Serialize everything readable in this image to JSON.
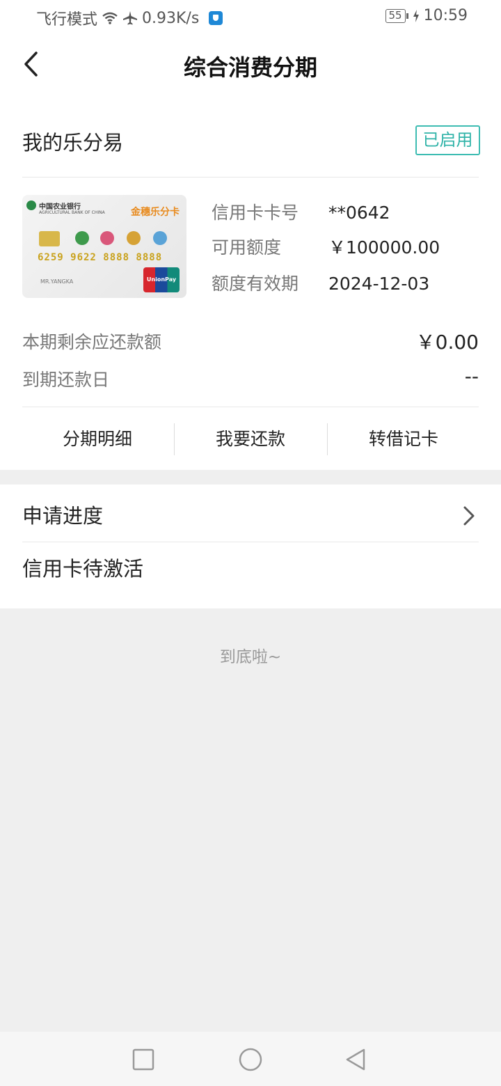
{
  "status_bar": {
    "airplane_text": "飞行模式",
    "speed": "0.93K/s",
    "battery": "55",
    "time": "10:59"
  },
  "header": {
    "title": "综合消费分期"
  },
  "installment": {
    "section_title": "我的乐分易",
    "status_badge": "已启用",
    "card": {
      "bank_name": "中国农业银行",
      "bank_sub": "AGRICULTURAL BANK OF CHINA",
      "brand": "金穗乐分卡",
      "number": "6259 9622 8888 8888",
      "holder": "MR.YANGKA",
      "network": "UnionPay 银联"
    },
    "card_no_label": "信用卡卡号",
    "card_no_value": "**0642",
    "limit_label": "可用额度",
    "limit_value": "￥100000.00",
    "validity_label": "额度有效期",
    "validity_value": "2024-12-03",
    "remaining_label": "本期剩余应还款额",
    "remaining_value": "￥0.00",
    "due_label": "到期还款日",
    "due_value": "--",
    "actions": [
      "分期明细",
      "我要还款",
      "转借记卡"
    ]
  },
  "progress": {
    "title": "申请进度",
    "status": "信用卡待激活"
  },
  "footer_text": "到底啦~",
  "icons": {
    "back": "chevron-left-icon",
    "forward": "chevron-right-icon",
    "wifi": "wifi-icon",
    "airplane": "airplane-icon",
    "shield": "shield-icon",
    "charging": "charging-icon"
  }
}
